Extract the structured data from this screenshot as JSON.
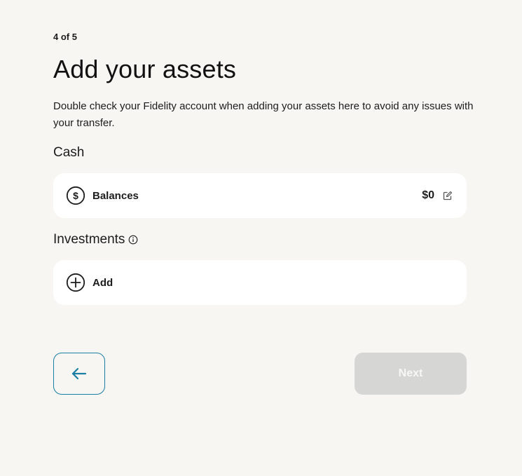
{
  "step_indicator": "4 of 5",
  "title": "Add your assets",
  "subtitle": "Double check your Fidelity account when adding your assets here to avoid any issues with your transfer.",
  "cash": {
    "heading": "Cash",
    "balances_label": "Balances",
    "balances_amount": "$0",
    "icon": "dollar-circle-icon",
    "edit_icon": "edit-icon"
  },
  "investments": {
    "heading": "Investments",
    "info_icon": "info-icon",
    "add_label": "Add",
    "add_icon": "plus-circle-icon"
  },
  "navigation": {
    "back_icon": "arrow-left-icon",
    "next_label": "Next"
  },
  "colors": {
    "background": "#f7f6f3",
    "card": "#ffffff",
    "accent": "#1a7fa3",
    "disabled_button": "#d6d6d4"
  }
}
